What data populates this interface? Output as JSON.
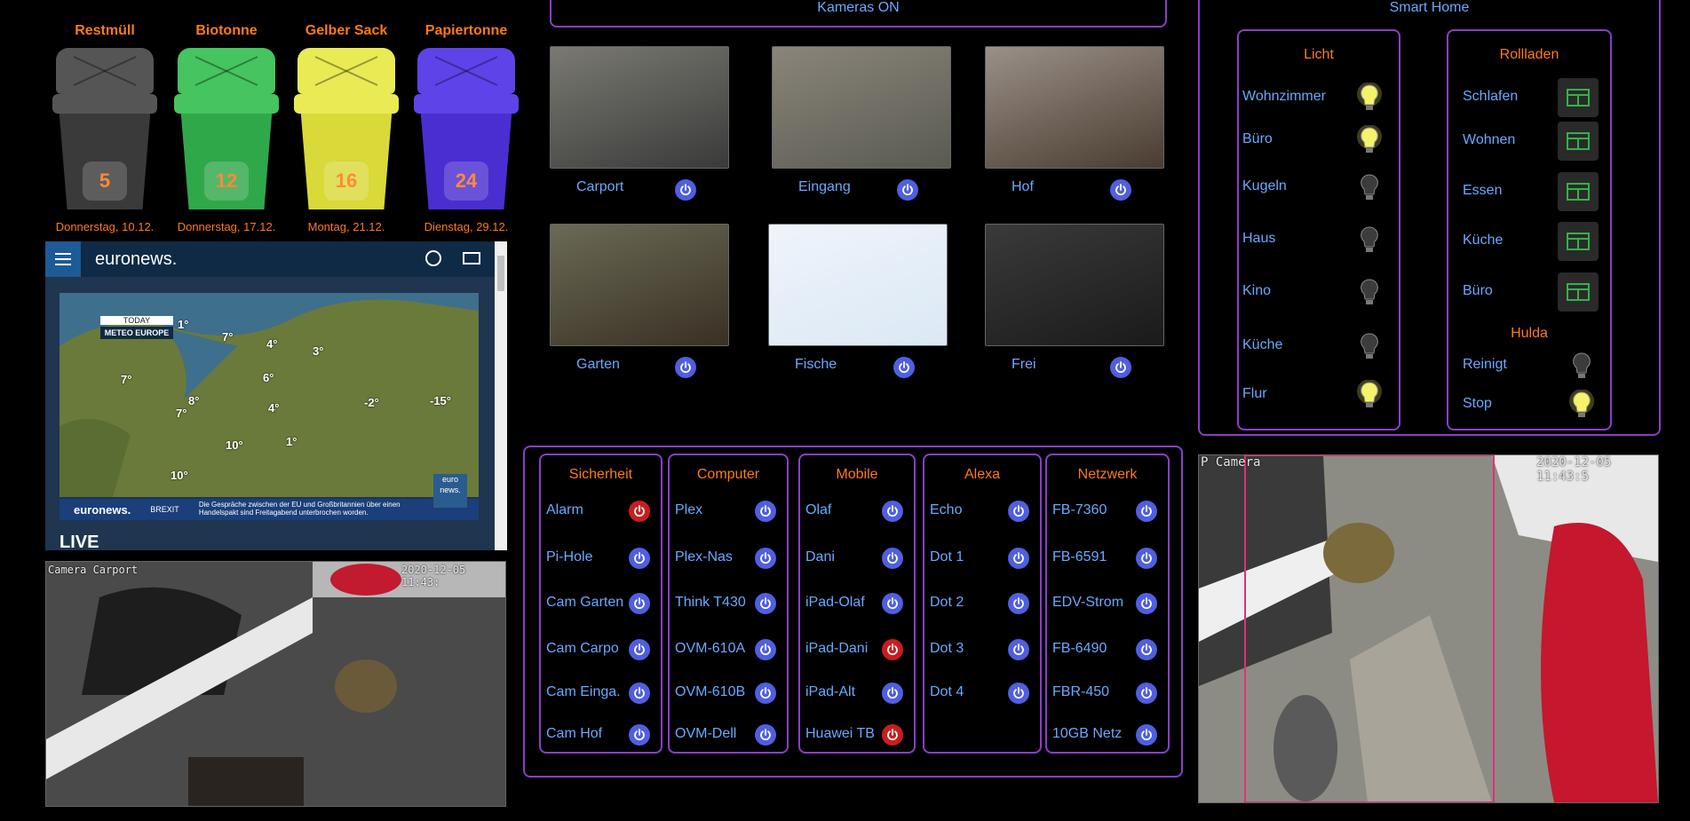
{
  "bins": [
    {
      "title": "Restmüll",
      "count": "5",
      "date": "Donnerstag, 10.12.",
      "color": "#3a3a3a",
      "rim": "#555555"
    },
    {
      "title": "Biotonne",
      "count": "12",
      "date": "Donnerstag, 17.12.",
      "color": "#2fa84a",
      "rim": "#45c45f"
    },
    {
      "title": "Gelber Sack",
      "count": "16",
      "date": "Montag, 21.12.",
      "color": "#d9d93a",
      "rim": "#eaea55"
    },
    {
      "title": "Papiertonne",
      "count": "24",
      "date": "Dienstag, 29.12.",
      "color": "#4a2ed0",
      "rim": "#5e43e8"
    }
  ],
  "news": {
    "brand": "euronews.",
    "today_label": "TODAY",
    "meteo_label": "METEO EUROPE",
    "ticker_brand": "euronews.",
    "ticker_tag": "BREXIT",
    "ticker_text": "Die Gespräche zwischen der EU und Großbritannien über einen Handelspakt sind Freitagabend unterbrochen worden.",
    "badge": "euro news.",
    "live": "LIVE",
    "temps": [
      "1°",
      "7°",
      "4°",
      "3°",
      "7°",
      "8°",
      "6°",
      "4°",
      "7°",
      "-2°",
      "-15°",
      "10°",
      "1°",
      "10°"
    ]
  },
  "carport_cam": {
    "label": "Camera Carport",
    "timestamp": "2020-12-05 11:43:"
  },
  "cameras": {
    "header": "Kameras ON",
    "items": [
      {
        "name": "Carport"
      },
      {
        "name": "Eingang"
      },
      {
        "name": "Hof"
      },
      {
        "name": "Garten"
      },
      {
        "name": "Fische"
      },
      {
        "name": "Frei"
      }
    ]
  },
  "groups": [
    {
      "title": "Sicherheit",
      "items": [
        {
          "name": "Alarm",
          "state": "off"
        },
        {
          "name": "Pi-Hole",
          "state": "on"
        },
        {
          "name": "Cam Garten",
          "state": "on"
        },
        {
          "name": "Cam Carpo",
          "state": "on"
        },
        {
          "name": "Cam Einga.",
          "state": "on"
        },
        {
          "name": "Cam Hof",
          "state": "on"
        }
      ]
    },
    {
      "title": "Computer",
      "items": [
        {
          "name": "Plex",
          "state": "on"
        },
        {
          "name": "Plex-Nas",
          "state": "on"
        },
        {
          "name": "Think T430",
          "state": "on"
        },
        {
          "name": "OVM-610A",
          "state": "on"
        },
        {
          "name": "OVM-610B",
          "state": "on"
        },
        {
          "name": "OVM-Dell",
          "state": "on"
        }
      ]
    },
    {
      "title": "Mobile",
      "items": [
        {
          "name": "Olaf",
          "state": "on"
        },
        {
          "name": "Dani",
          "state": "on"
        },
        {
          "name": "iPad-Olaf",
          "state": "on"
        },
        {
          "name": "iPad-Dani",
          "state": "off"
        },
        {
          "name": "iPad-Alt",
          "state": "on"
        },
        {
          "name": "Huawei TB",
          "state": "off"
        }
      ]
    },
    {
      "title": "Alexa",
      "items": [
        {
          "name": "Echo",
          "state": "on"
        },
        {
          "name": "Dot 1",
          "state": "on"
        },
        {
          "name": "Dot 2",
          "state": "on"
        },
        {
          "name": "Dot 3",
          "state": "on"
        },
        {
          "name": "Dot 4",
          "state": "on"
        }
      ]
    },
    {
      "title": "Netzwerk",
      "items": [
        {
          "name": "FB-7360",
          "state": "on"
        },
        {
          "name": "FB-6591",
          "state": "on"
        },
        {
          "name": "EDV-Strom",
          "state": "on"
        },
        {
          "name": "FB-6490",
          "state": "on"
        },
        {
          "name": "FBR-450",
          "state": "on"
        },
        {
          "name": "10GB Netz",
          "state": "on"
        }
      ]
    }
  ],
  "smart_home": {
    "header": "Smart Home",
    "licht": {
      "title": "Licht",
      "items": [
        {
          "name": "Wohnzimmer",
          "on": true
        },
        {
          "name": "Büro",
          "on": true
        },
        {
          "name": "Kugeln",
          "on": false
        },
        {
          "name": "Haus",
          "on": false
        },
        {
          "name": "Kino",
          "on": false
        },
        {
          "name": "Küche",
          "on": false
        },
        {
          "name": "Flur",
          "on": true
        }
      ]
    },
    "rollladen": {
      "title": "Rollladen",
      "items": [
        {
          "name": "Schlafen"
        },
        {
          "name": "Wohnen"
        },
        {
          "name": "Essen"
        },
        {
          "name": "Küche"
        },
        {
          "name": "Büro"
        }
      ]
    },
    "hulda": {
      "title": "Hulda",
      "items": [
        {
          "name": "Reinigt",
          "on": false
        },
        {
          "name": "Stop",
          "on": true
        }
      ]
    }
  },
  "ip_cam": {
    "label": "P Camera",
    "timestamp": "2020-12-05 11:43:5"
  },
  "colors": {
    "accent": "#6aa9ff",
    "heading": "#ff7a1a",
    "border": "#8a3ec8",
    "power_on": "#4f5fe0",
    "power_off": "#c81e1e"
  }
}
